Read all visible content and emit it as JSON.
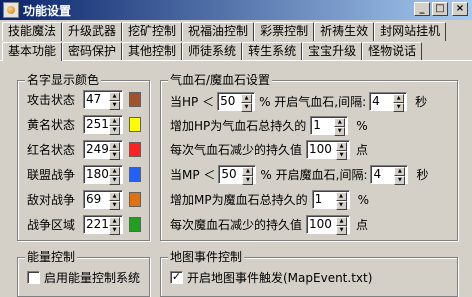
{
  "window": {
    "title": "功能设置",
    "min_glyph": "_",
    "max_glyph": "□",
    "close_glyph": "×"
  },
  "tabs_row1": [
    "技能魔法",
    "升级武器",
    "挖矿控制",
    "祝福油控制",
    "彩票控制",
    "祈祷生效",
    "封网站挂机"
  ],
  "tabs_row2": [
    "基本功能",
    "密码保护",
    "其他控制",
    "师徒系统",
    "转生系统",
    "宝宝升级",
    "怪物说话"
  ],
  "active_tab": "基本功能",
  "name_colors": {
    "title": "名字显示颜色",
    "items": [
      {
        "label": "攻击状态",
        "value": "47",
        "color": "#a0522d"
      },
      {
        "label": "黄名状态",
        "value": "251",
        "color": "#ffff00"
      },
      {
        "label": "红名状态",
        "value": "249",
        "color": "#ff2020"
      },
      {
        "label": "联盟战争",
        "value": "180",
        "color": "#2060ff"
      },
      {
        "label": "敌对战争",
        "value": "69",
        "color": "#e07010"
      },
      {
        "label": "战争区域",
        "value": "221",
        "color": "#20a020"
      }
    ]
  },
  "stones": {
    "title": "气血石/魔血石设置",
    "hp_row": {
      "prefix": "当HP ＜",
      "value": "50",
      "suffix": "% 开启气血石,间隔:",
      "interval": "4",
      "unit": "秒"
    },
    "hp_add": {
      "label": "增加HP为气血石总持久的",
      "value": "1",
      "unit": "%"
    },
    "hp_dec": {
      "label": "每次气血石减少的持久值",
      "value": "100",
      "unit": "点"
    },
    "mp_row": {
      "prefix": "当MP ＜",
      "value": "50",
      "suffix": "% 开启魔血石,间隔:",
      "interval": "4",
      "unit": "秒"
    },
    "mp_add": {
      "label": "增加MP为魔血石总持久的",
      "value": "1",
      "unit": "%"
    },
    "mp_dec": {
      "label": "每次魔血石减少的持久值",
      "value": "100",
      "unit": "点"
    }
  },
  "energy": {
    "title": "能量控制",
    "checkbox_label": "启用能量控制系统",
    "checked": false
  },
  "map_event": {
    "title": "地图事件控制",
    "checkbox_label": "开启地图事件触发(MapEvent.txt)",
    "checked": true,
    "check_glyph": "✓"
  }
}
